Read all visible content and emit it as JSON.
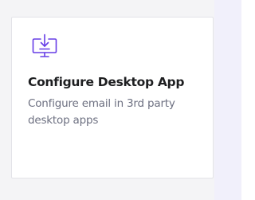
{
  "card": {
    "icon": "desktop-download-icon",
    "title": "Configure Desktop App",
    "description": "Configure email in 3rd party desktop apps"
  },
  "colors": {
    "accent": "#673de6",
    "page_background": "#f4f4f6",
    "side_panel_background": "#f1f0fb",
    "title_text": "#1d1e20",
    "description_text": "#6d7081"
  }
}
